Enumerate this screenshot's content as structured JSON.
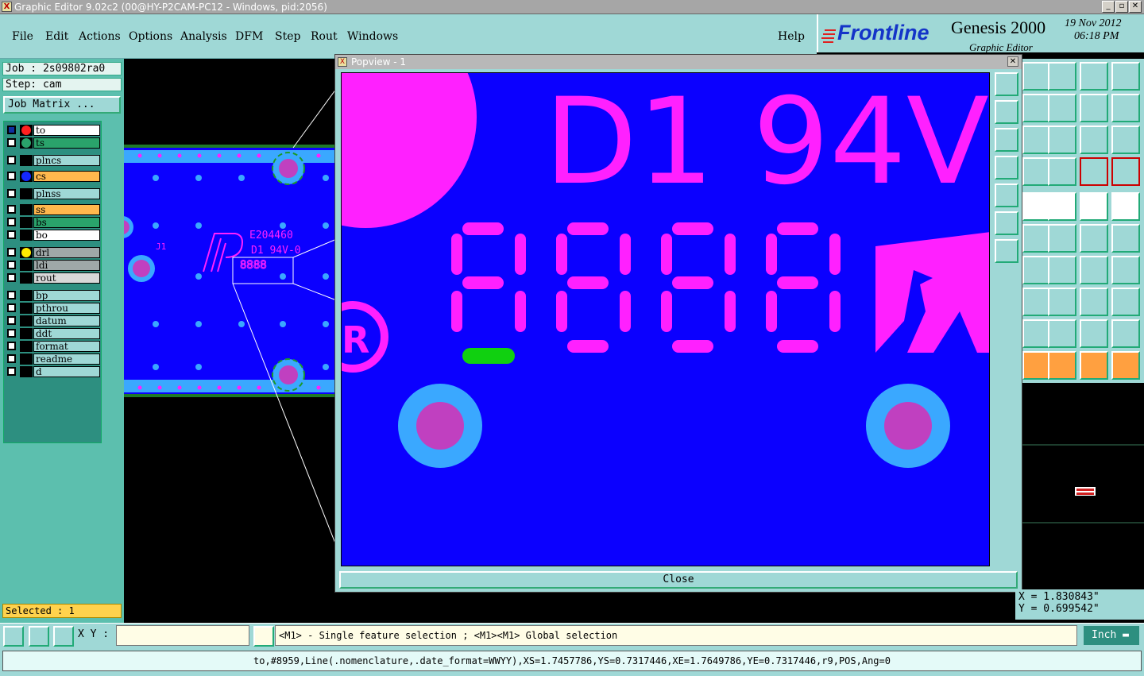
{
  "window": {
    "title": "Graphic Editor 9.02c2 (00@HY-P2CAM-PC12 - Windows, pid:2056)",
    "icon": "app-x-icon"
  },
  "menu": {
    "items": [
      "File",
      "Edit",
      "Actions",
      "Options",
      "Analysis",
      "DFM",
      "Step",
      "Rout",
      "Windows"
    ],
    "help": "Help"
  },
  "logo": {
    "brand": "Frontline",
    "product": "Genesis 2000",
    "subtitle": "Graphic Editor",
    "date": "19 Nov 2012",
    "time": "06:18 PM"
  },
  "job": {
    "job_label": "Job : 2s09802ra0",
    "step_label": "Step: cam",
    "matrix_button": "Job Matrix ..."
  },
  "layers": [
    {
      "name": "to",
      "color": "#ffffff",
      "dot": "#ff2020",
      "active": true
    },
    {
      "name": "ts",
      "color": "#2aa36b",
      "dot": "#2aa36b"
    },
    {
      "name": "plncs",
      "color": "#9fd8d6",
      "dot": ""
    },
    {
      "name": "cs",
      "color": "#ffb84d",
      "dot": "#1428ff"
    },
    {
      "name": "plnss",
      "color": "#9fd8d6",
      "dot": ""
    },
    {
      "name": "ss",
      "color": "#ffb84d",
      "dot": ""
    },
    {
      "name": "bs",
      "color": "#2aa36b",
      "dot": ""
    },
    {
      "name": "bo",
      "color": "#ffffff",
      "dot": ""
    },
    {
      "name": "drl",
      "color": "#9fa8a8",
      "dot": "#ffea00"
    },
    {
      "name": "ldi",
      "color": "#9fa8a8",
      "dot": ""
    },
    {
      "name": "rout",
      "color": "#d8d8d8",
      "dot": ""
    },
    {
      "name": "bp",
      "color": "#9fd8d6",
      "dot": ""
    },
    {
      "name": "pthrou",
      "color": "#9fd8d6",
      "dot": ""
    },
    {
      "name": "datum",
      "color": "#9fd8d6",
      "dot": ""
    },
    {
      "name": "ddt",
      "color": "#9fd8d6",
      "dot": ""
    },
    {
      "name": "format",
      "color": "#9fd8d6",
      "dot": ""
    },
    {
      "name": "readme",
      "color": "#9fd8d6",
      "dot": ""
    },
    {
      "name": "d",
      "color": "#9fd8d6",
      "dot": ""
    }
  ],
  "selected": "Selected : 1",
  "board": {
    "ul_code": "E204460",
    "marking": "D1 94V-0",
    "ref": "J1"
  },
  "popview": {
    "title": "Popview - 1",
    "marking_big": "D1 94V",
    "close_button": "Close",
    "registered": "R"
  },
  "coords": {
    "x": "X = 1.830843\"",
    "y": "Y = 0.699542\""
  },
  "bottom": {
    "xy_label": "X Y :",
    "xy_value": "",
    "message": "<M1> - Single feature selection ; <M1><M1> Global selection",
    "units": "Inch"
  },
  "status": "to,#8959,Line(.nomenclature,.date_format=WWYY),XS=1.7457786,YS=0.7317446,XE=1.7649786,YE=0.7317446,r9,POS,Ang=0",
  "colors": {
    "panel": "#9fd8d6",
    "board": "#0b00ff",
    "silkscreen": "#ff20ff",
    "pad_ring": "#3aa8ff",
    "selection": "#10d010"
  }
}
